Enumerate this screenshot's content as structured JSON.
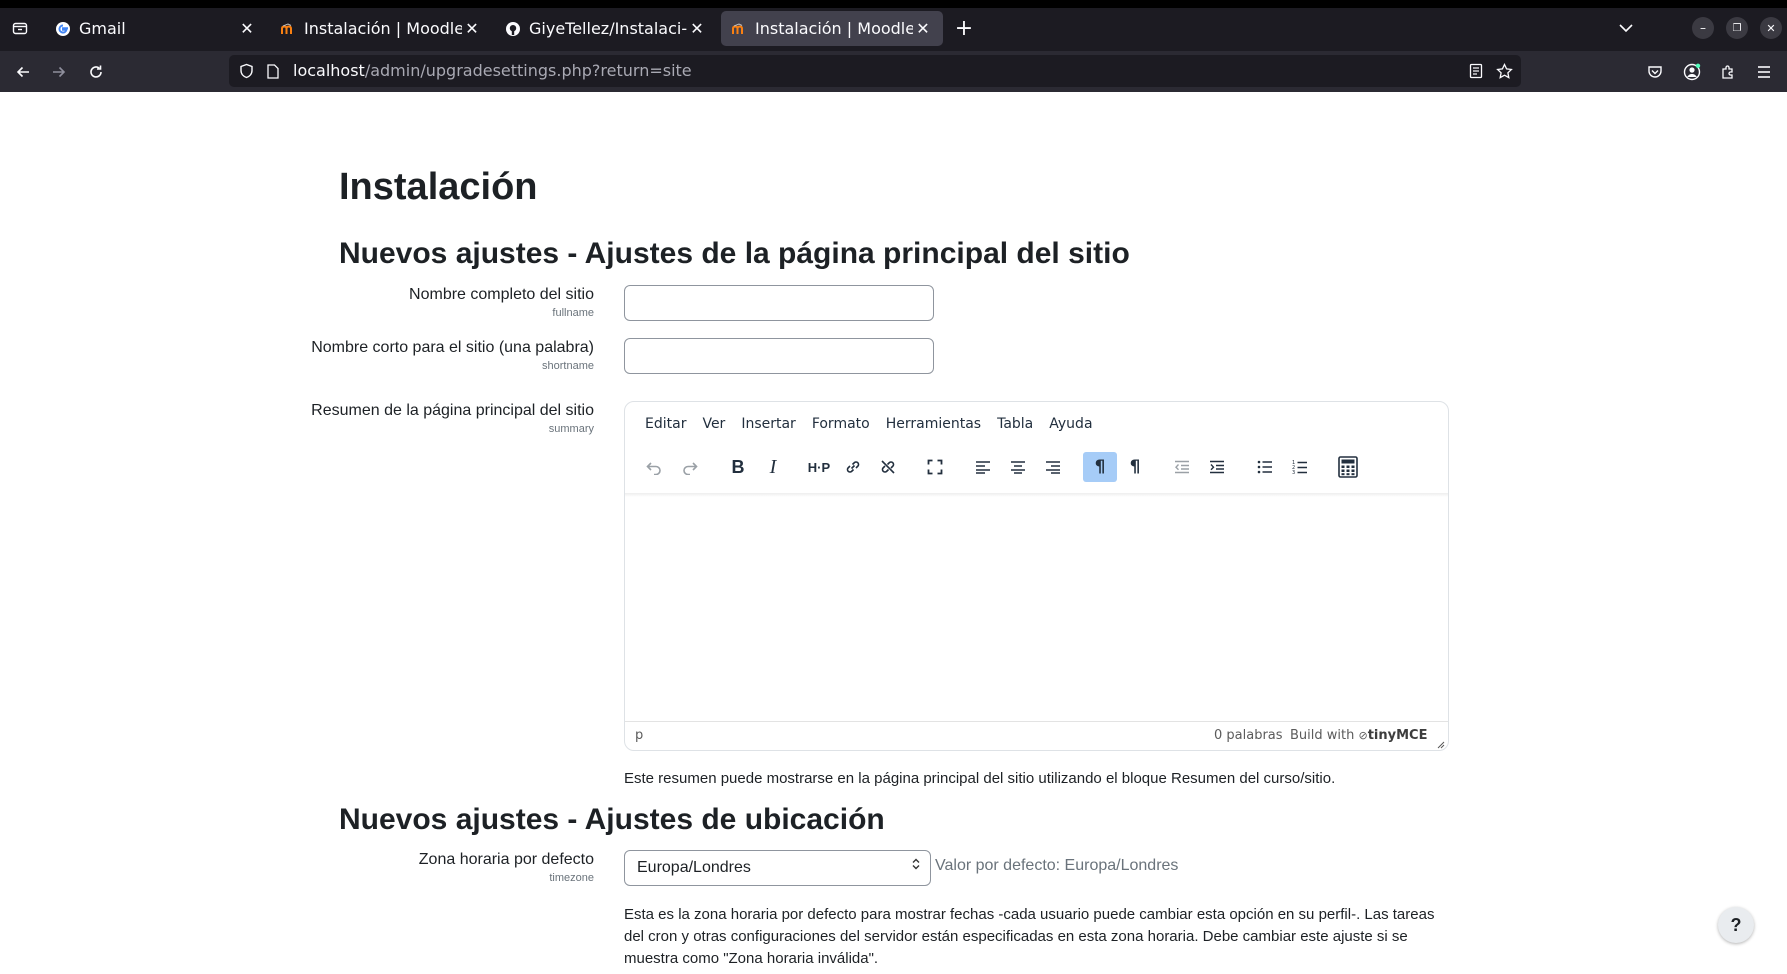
{
  "browser": {
    "tabs": [
      {
        "title": "Gmail",
        "favicon": "google-icon",
        "active": false
      },
      {
        "title": "Instalación | Moodle",
        "favicon": "moodle-icon",
        "active": false
      },
      {
        "title": "GiyeTellez/Instalaci-n-Mo",
        "favicon": "github-icon",
        "active": false
      },
      {
        "title": "Instalación | Moodle",
        "favicon": "moodle-icon",
        "active": true
      }
    ],
    "url_host": "localhost",
    "url_path": "/admin/upgradesettings.php?return=site"
  },
  "page": {
    "title": "Instalación",
    "section1_title": "Nuevos ajustes - Ajustes de la página principal del sitio",
    "fields": {
      "fullname": {
        "label": "Nombre completo del sitio",
        "key": "fullname",
        "value": ""
      },
      "shortname": {
        "label": "Nombre corto para el sitio (una palabra)",
        "key": "shortname",
        "value": ""
      },
      "summary": {
        "label": "Resumen de la página principal del sitio",
        "key": "summary"
      }
    },
    "editor": {
      "menu": [
        "Editar",
        "Ver",
        "Insertar",
        "Formato",
        "Herramientas",
        "Tabla",
        "Ayuda"
      ],
      "status_path": "p",
      "word_count": "0 palabras",
      "build_with": "Build with",
      "brand": "tinyMCE"
    },
    "summary_help": "Este resumen puede mostrarse en la página principal del sitio utilizando el bloque Resumen del curso/sitio.",
    "section2_title": "Nuevos ajustes - Ajustes de ubicación",
    "timezone": {
      "label": "Zona horaria por defecto",
      "key": "timezone",
      "selected": "Europa/Londres",
      "default_text": "Valor por defecto: Europa/Londres",
      "help": "Esta es la zona horaria por defecto para mostrar fechas -cada usuario puede cambiar esta opción en su perfil-. Las tareas del cron y otras configuraciones del servidor están especificadas en esta zona horaria. Debe cambiar este ajuste si se muestra como \"Zona horaria inválida\"."
    },
    "help_button": "?"
  }
}
